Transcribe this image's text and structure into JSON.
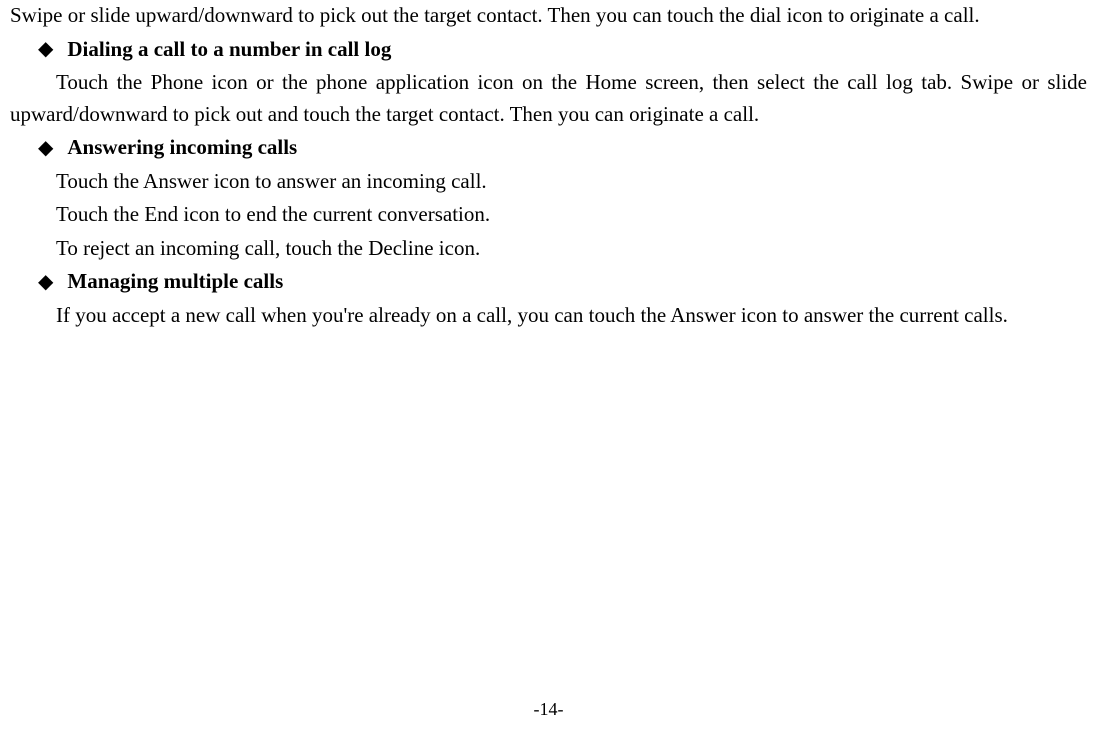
{
  "intro": "Swipe or slide upward/downward to pick out the target contact. Then you can touch the dial icon to originate a call.",
  "sections": [
    {
      "heading": "Dialing a call to a number in call log",
      "paragraphs": [
        "Touch the Phone icon or the phone application icon on the Home screen, then select the call log tab. Swipe or slide upward/downward to pick out and touch the target contact. Then you can originate a call."
      ]
    },
    {
      "heading": "Answering incoming calls",
      "paragraphs": [
        "Touch the Answer icon to answer an incoming call.",
        "Touch the End icon to end the current conversation.",
        "To reject an incoming call, touch the Decline icon."
      ]
    },
    {
      "heading": "Managing multiple calls",
      "paragraphs": [
        "If you accept a new call when you're already on a call, you can touch the Answer icon to answer the current calls."
      ]
    }
  ],
  "pageNumber": "-14-",
  "bulletChar": "◆"
}
